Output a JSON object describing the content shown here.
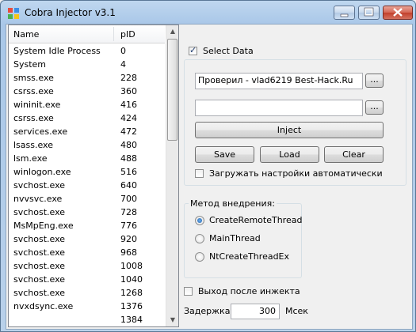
{
  "window": {
    "title": "Cobra Injector v3.1",
    "colors": {
      "title_bar": "#b9d1ea",
      "client": "#f0f0f0",
      "close_button": "#c2402c"
    }
  },
  "process_list": {
    "columns": {
      "name": "Name",
      "pid": "pID"
    },
    "rows": [
      {
        "name": "System Idle Process",
        "pid": "0"
      },
      {
        "name": "System",
        "pid": "4"
      },
      {
        "name": "smss.exe",
        "pid": "228"
      },
      {
        "name": "csrss.exe",
        "pid": "360"
      },
      {
        "name": "wininit.exe",
        "pid": "416"
      },
      {
        "name": "csrss.exe",
        "pid": "424"
      },
      {
        "name": "services.exe",
        "pid": "472"
      },
      {
        "name": "lsass.exe",
        "pid": "480"
      },
      {
        "name": "lsm.exe",
        "pid": "488"
      },
      {
        "name": "winlogon.exe",
        "pid": "516"
      },
      {
        "name": "svchost.exe",
        "pid": "640"
      },
      {
        "name": "nvvsvc.exe",
        "pid": "700"
      },
      {
        "name": "svchost.exe",
        "pid": "728"
      },
      {
        "name": "MsMpEng.exe",
        "pid": "776"
      },
      {
        "name": "svchost.exe",
        "pid": "920"
      },
      {
        "name": "svchost.exe",
        "pid": "968"
      },
      {
        "name": "svchost.exe",
        "pid": "1008"
      },
      {
        "name": "svchost.exe",
        "pid": "1040"
      },
      {
        "name": "svchost.exe",
        "pid": "1268"
      },
      {
        "name": "nvxdsync.exe",
        "pid": "1376"
      },
      {
        "name": "",
        "pid": "1384"
      }
    ]
  },
  "select_data": {
    "label": "Select Data",
    "checked": true,
    "dll_path": "Проверил - vlad6219 Best-Hack.Ru",
    "process_path": "",
    "browse_label": "...",
    "inject_label": "Inject",
    "save_label": "Save",
    "load_label": "Load",
    "clear_label": "Clear",
    "autoload_label": "Загружать настройки автоматически",
    "autoload_checked": false
  },
  "injection_method": {
    "title": "Метод внедрения:",
    "options": [
      "CreateRemoteThread",
      "MainThread",
      "NtCreateThreadEx"
    ],
    "selected": "CreateRemoteThread"
  },
  "exit_after_inject": {
    "label": "Выход после инжекта",
    "checked": false
  },
  "delay": {
    "label": "Задержка:",
    "value": "300",
    "unit": "Мсек"
  }
}
